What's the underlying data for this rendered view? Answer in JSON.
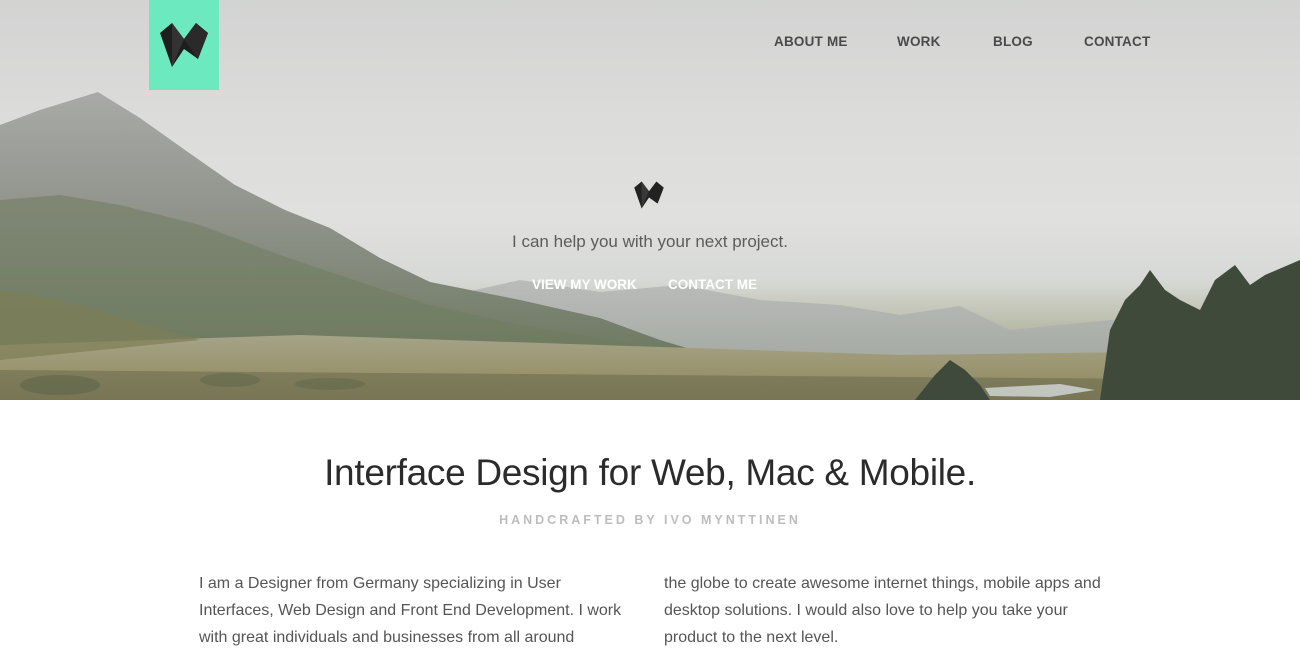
{
  "header": {
    "nav": [
      {
        "label": "ABOUT ME"
      },
      {
        "label": "WORK"
      },
      {
        "label": "BLOG"
      },
      {
        "label": "CONTACT"
      }
    ],
    "logo_color": "#6de9c0"
  },
  "hero": {
    "tagline": "I can help you with your next project.",
    "cta_primary": "VIEW MY WORK",
    "cta_secondary": "CONTACT ME"
  },
  "intro": {
    "headline": "Interface Design for Web, Mac & Mobile.",
    "subhead": "HANDCRAFTED BY IVO MYNTTINEN",
    "paragraph_left": "I am a Designer from Germany specializing in User Interfaces, Web Design and Front End Development. I work with great individuals and businesses from all around",
    "paragraph_right": "the globe to create awesome internet things, mobile apps and desktop solutions. I would also love to help you take your product to the next level."
  }
}
